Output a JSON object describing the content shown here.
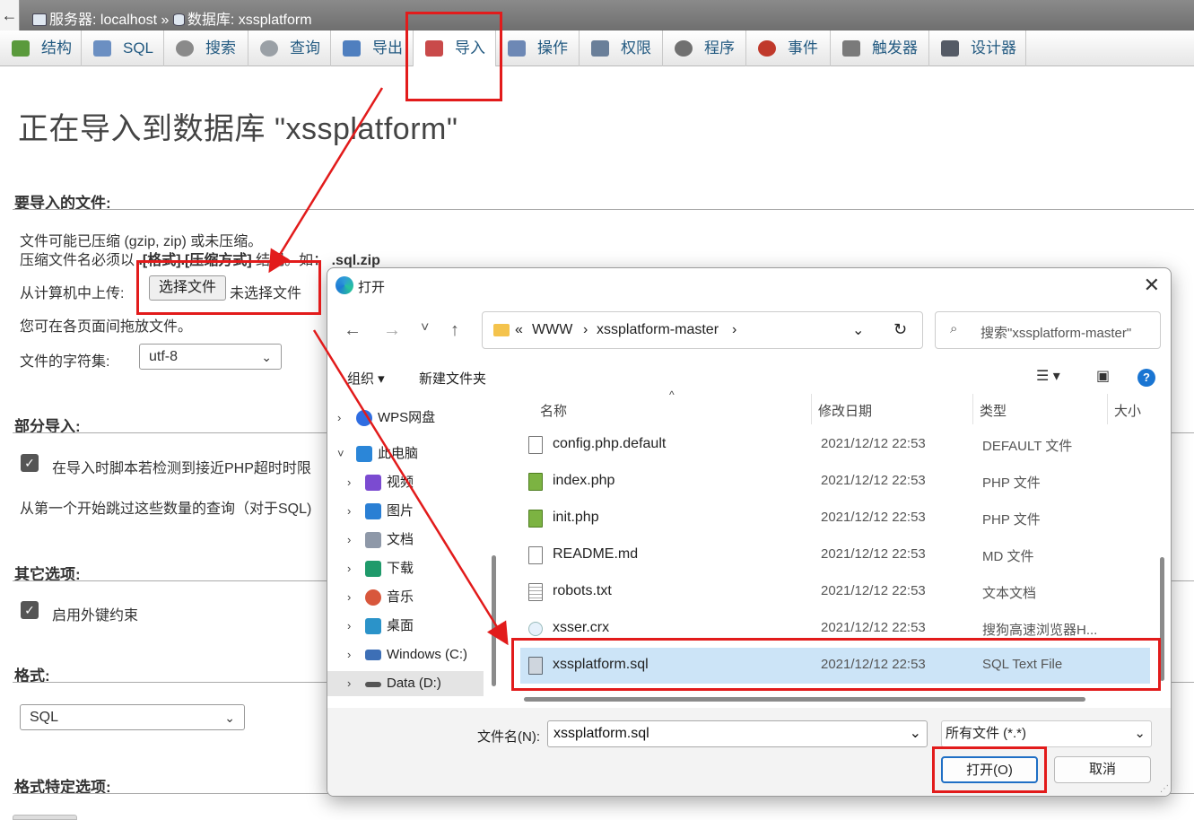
{
  "topbar": {
    "back": "←",
    "server_label": "服务器: localhost",
    "separator": "»",
    "db_label": "数据库: xssplatform"
  },
  "tabs": [
    {
      "label": "结构",
      "icon": "structure-icon",
      "color": "#5a9a3c"
    },
    {
      "label": "SQL",
      "icon": "sql-icon",
      "color": "#6b8fc2"
    },
    {
      "label": "搜索",
      "icon": "search-icon",
      "color": "#8a8a8a"
    },
    {
      "label": "查询",
      "icon": "query-icon",
      "color": "#9aa0a6"
    },
    {
      "label": "导出",
      "icon": "export-icon",
      "color": "#4f7fbf"
    },
    {
      "label": "导入",
      "icon": "import-icon",
      "color": "#c94a4a"
    },
    {
      "label": "操作",
      "icon": "wrench-icon",
      "color": "#6d88b5"
    },
    {
      "label": "权限",
      "icon": "privileges-icon",
      "color": "#6a7f99"
    },
    {
      "label": "程序",
      "icon": "routines-icon",
      "color": "#707070"
    },
    {
      "label": "事件",
      "icon": "clock-icon",
      "color": "#c0392b"
    },
    {
      "label": "触发器",
      "icon": "triggers-icon",
      "color": "#7a7a7a"
    },
    {
      "label": "设计器",
      "icon": "designer-icon",
      "color": "#555b66"
    }
  ],
  "main": {
    "heading": "正在导入到数据库 \"xssplatform\"",
    "file_section": "要导入的文件:",
    "compress_note": "文件可能已压缩 (gzip, zip) 或未压缩。",
    "naming_note_prefix": "压缩文件名必须以",
    "naming_note_pattern": ".[格式].[压缩方式]",
    "naming_note_mid": "结尾。如：",
    "naming_note_example": ".sql.zip",
    "upload_label": "从计算机中上传:",
    "choose_file_button": "选择文件",
    "no_file_text": "未选择文件",
    "drag_note": "您可在各页面间拖放文件。",
    "charset_label": "文件的字符集:",
    "charset_value": "utf-8",
    "partial_section": "部分导入:",
    "timeout_option": "在导入时脚本若检测到接近PHP超时时限",
    "skip_label": "从第一个开始跳过这些数量的查询（对于SQL)",
    "other_section": "其它选项:",
    "fk_option": "启用外键约束",
    "format_section": "格式:",
    "format_value": "SQL",
    "format_specific_section": "格式特定选项:"
  },
  "dialog": {
    "title": "打开",
    "close": "✕",
    "nav": {
      "back": "←",
      "forward": "→",
      "recent": "˅",
      "up": "↑"
    },
    "path": [
      "«",
      "WWW",
      "›",
      "xssplatform-master",
      "›"
    ],
    "search_placeholder": "搜索\"xssplatform-master\"",
    "organize": "组织 ▾",
    "new_folder": "新建文件夹",
    "help": "?",
    "nav_items": [
      {
        "label": "WPS网盘",
        "icon": "cloud-icon",
        "color": "#2f6de1",
        "chev": "›"
      },
      {
        "label": "此电脑",
        "icon": "computer-icon",
        "color": "#2b86d8",
        "chev": "˅"
      },
      {
        "label": "视频",
        "icon": "video-icon",
        "color": "#7b4bd1",
        "chev": "›"
      },
      {
        "label": "图片",
        "icon": "pictures-icon",
        "color": "#2a7fd4",
        "chev": "›"
      },
      {
        "label": "文档",
        "icon": "documents-icon",
        "color": "#8e98a8",
        "chev": "›"
      },
      {
        "label": "下载",
        "icon": "download-icon",
        "color": "#1f9a6b",
        "chev": "›"
      },
      {
        "label": "音乐",
        "icon": "music-icon",
        "color": "#d8573c",
        "chev": "›"
      },
      {
        "label": "桌面",
        "icon": "desktop-icon",
        "color": "#2b93c9",
        "chev": "›"
      },
      {
        "label": "Windows (C:)",
        "icon": "drive-c-icon",
        "color": "#3d6fb6",
        "chev": "›"
      },
      {
        "label": "Data (D:)",
        "icon": "drive-d-icon",
        "color": "#555555",
        "chev": "›"
      }
    ],
    "columns": {
      "name": "名称",
      "date": "修改日期",
      "type": "类型",
      "size": "大小"
    },
    "files": [
      {
        "name": "config.php.default",
        "date": "2021/12/12 22:53",
        "type": "DEFAULT 文件"
      },
      {
        "name": "index.php",
        "date": "2021/12/12 22:53",
        "type": "PHP 文件"
      },
      {
        "name": "init.php",
        "date": "2021/12/12 22:53",
        "type": "PHP 文件"
      },
      {
        "name": "README.md",
        "date": "2021/12/12 22:53",
        "type": "MD 文件"
      },
      {
        "name": "robots.txt",
        "date": "2021/12/12 22:53",
        "type": "文本文档"
      },
      {
        "name": "xsser.crx",
        "date": "2021/12/12 22:53",
        "type": "搜狗高速浏览器H..."
      },
      {
        "name": "xssplatform.sql",
        "date": "2021/12/12 22:53",
        "type": "SQL Text File"
      }
    ],
    "filename_label": "文件名(N):",
    "filename_value": "xssplatform.sql",
    "filter_value": "所有文件 (*.*)",
    "open_button": "打开(O)",
    "cancel_button": "取消"
  },
  "colors": {
    "annotation": "#e21b1b",
    "link": "#235a81",
    "selected_row": "#cce4f7",
    "primary": "#1f6fc5"
  }
}
